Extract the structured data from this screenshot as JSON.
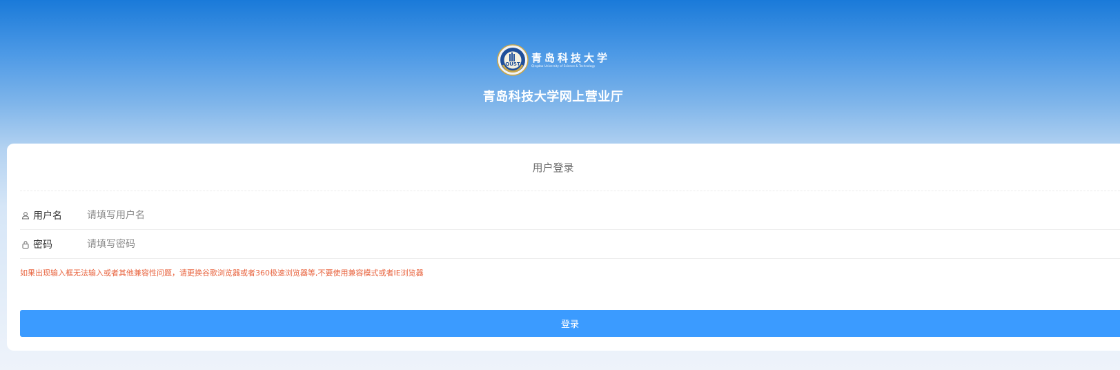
{
  "header": {
    "logo_cn": "青岛科技大学",
    "logo_en": "Qingdao University of Science & Technology",
    "seal_text": "QUST",
    "portal_title": "青岛科技大学网上营业厅"
  },
  "login_card": {
    "title": "用户登录",
    "username_label": "用户名",
    "username_placeholder": "请填写用户名",
    "password_label": "密码",
    "password_placeholder": "请填写密码",
    "notice": "如果出现输入框无法输入或者其他兼容性问题，请更换谷歌浏览器或者360极速浏览器等,不要使用兼容模式或者IE浏览器",
    "login_button_label": "登录"
  },
  "icons": {
    "username": "user-icon",
    "password": "lock-icon"
  },
  "colors": {
    "primary_button": "#3b9bff",
    "notice_text": "#e8643f",
    "header_top": "#1a7ad9"
  }
}
